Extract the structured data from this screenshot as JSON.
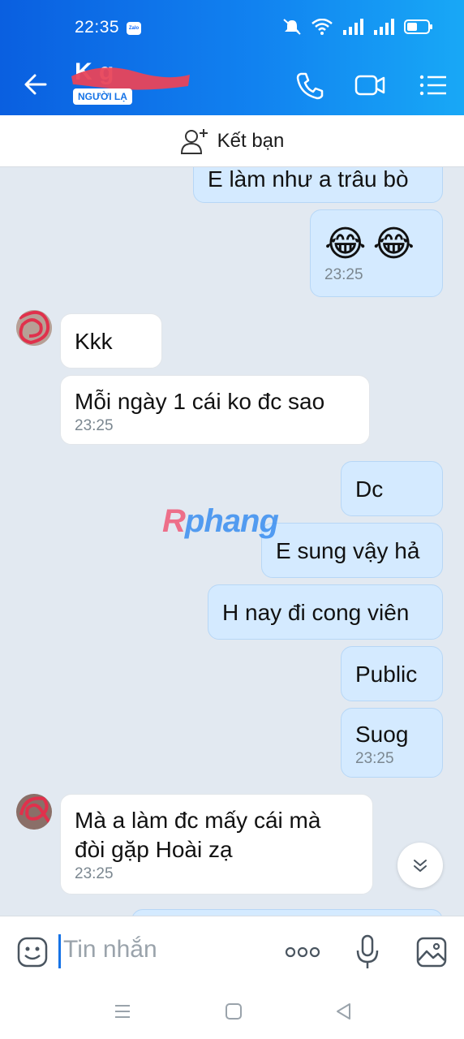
{
  "status": {
    "time": "22:35",
    "app_badge": "Zalo"
  },
  "header": {
    "contact_name": "K         g",
    "badge": "NGƯỜI LẠ"
  },
  "friend_bar": {
    "label": "Kết bạn"
  },
  "messages": [
    {
      "dir": "out",
      "text": "E làm như a trâu bò"
    },
    {
      "dir": "out",
      "text": "😂 😂",
      "time": "23:25"
    },
    {
      "dir": "in",
      "text": "Kkk"
    },
    {
      "dir": "in",
      "text": "Mỗi ngày 1 cái ko đc sao",
      "time": "23:25"
    },
    {
      "dir": "out",
      "text": "Dc"
    },
    {
      "dir": "out",
      "text": "E sung vậy hả"
    },
    {
      "dir": "out",
      "text": "H nay đi cong viên"
    },
    {
      "dir": "out",
      "text": "Public"
    },
    {
      "dir": "out",
      "text": "Suog",
      "time": "23:25"
    },
    {
      "dir": "in",
      "text": "Mà a làm đc mấy cái mà",
      "text2": "đòi gặp Hoài zạ",
      "time": "23:25"
    }
  ],
  "watermark": {
    "first": "R",
    "rest": "phang"
  },
  "composer": {
    "placeholder": "Tin nhắn"
  },
  "colors": {
    "brand": "#1182f0",
    "bubble_out": "#d4eaff",
    "bubble_in": "#ffffff",
    "chat_bg": "#e2e9f1"
  },
  "icons": [
    "back-arrow-icon",
    "phone-icon",
    "video-call-icon",
    "menu-list-icon",
    "add-friend-icon",
    "scroll-down-icon",
    "sticker-icon",
    "more-icon",
    "microphone-icon",
    "image-icon"
  ]
}
